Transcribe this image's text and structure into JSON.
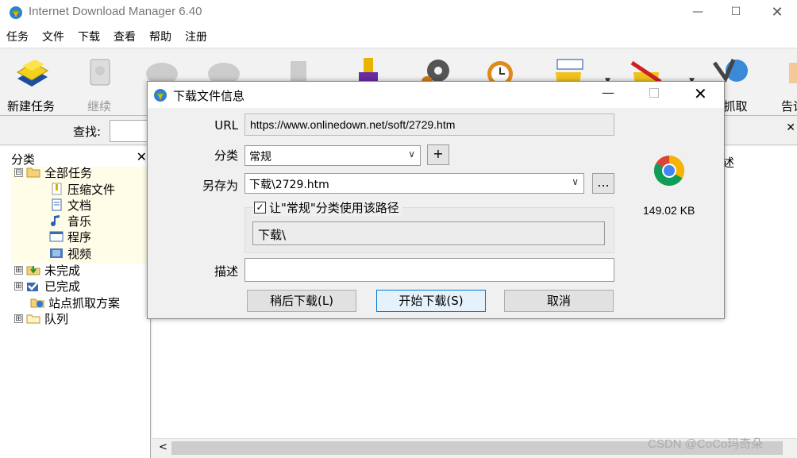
{
  "window": {
    "title": "Internet Download Manager 6.40",
    "min_glyph": "—",
    "max_glyph": "☐",
    "close_glyph": "✕"
  },
  "menu": [
    "任务",
    "文件",
    "下载",
    "查看",
    "帮助",
    "注册"
  ],
  "toolbar": {
    "new_task": "新建任务",
    "resume": "继续",
    "site_grab": "点抓取",
    "tell": "告诉"
  },
  "search": {
    "label": "查找:",
    "value": ""
  },
  "sidebar": {
    "header": "分类",
    "close": "✕",
    "items": [
      {
        "label": "全部任务",
        "expander": "⊟"
      },
      {
        "label": "压缩文件"
      },
      {
        "label": "文档"
      },
      {
        "label": "音乐"
      },
      {
        "label": "程序"
      },
      {
        "label": "视频"
      },
      {
        "label": "未完成",
        "expander": "⊞"
      },
      {
        "label": "已完成",
        "expander": "⊞"
      },
      {
        "label": "站点抓取方案"
      },
      {
        "label": "队列",
        "expander": "⊞"
      }
    ]
  },
  "content": {
    "desc_header_fragment": "述"
  },
  "scroll": {
    "left_arrow": "<"
  },
  "watermark": "CSDN @CoCo玛奇朵",
  "dialog": {
    "title": "下载文件信息",
    "min_glyph": "—",
    "close_glyph": "✕",
    "url_label": "URL",
    "url_value": "https://www.onlinedown.net/soft/2729.htm",
    "category_label": "分类",
    "category_value": "常规",
    "add_button": "+",
    "saveas_label": "另存为",
    "saveas_value": "下载\\2729.htm",
    "browse_button": "...",
    "checkbox_checked": "✓",
    "checkbox_label": "让\"常规\"分类使用该路径",
    "path_value": "下载\\",
    "desc_label": "描述",
    "desc_value": "",
    "file_size": "149.02 KB",
    "buttons": {
      "later": "稍后下载(L)",
      "start": "开始下载(S)",
      "cancel": "取消"
    }
  }
}
